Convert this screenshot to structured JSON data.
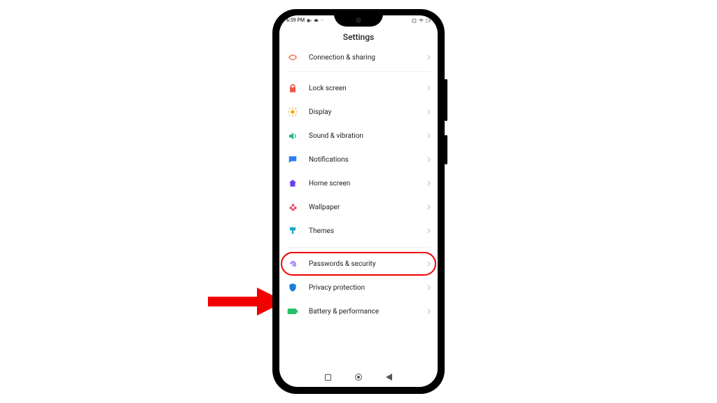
{
  "status": {
    "time": "6:59 PM",
    "icons_left": [
      "record-icon",
      "cloud-icon",
      "dots-icon"
    ],
    "icons_right": [
      "rotate-icon",
      "wifi-icon",
      "battery-icon"
    ]
  },
  "header": {
    "title": "Settings"
  },
  "groups": [
    {
      "rows": [
        {
          "id": "connection-sharing",
          "icon": "share-icon",
          "color": "#f26a3f",
          "label": "Connection & sharing"
        }
      ]
    },
    {
      "rows": [
        {
          "id": "lock-screen",
          "icon": "lock-icon",
          "color": "#f05a4a",
          "label": "Lock screen"
        },
        {
          "id": "display",
          "icon": "sun-icon",
          "color": "#f7a70b",
          "label": "Display"
        },
        {
          "id": "sound",
          "icon": "sound-icon",
          "color": "#1fbb7d",
          "label": "Sound & vibration"
        },
        {
          "id": "notifications",
          "icon": "msg-icon",
          "color": "#2e7bf6",
          "label": "Notifications"
        },
        {
          "id": "home-screen",
          "icon": "home-icon",
          "color": "#6a3df5",
          "label": "Home screen"
        },
        {
          "id": "wallpaper",
          "icon": "flower-icon",
          "color": "#e75470",
          "label": "Wallpaper"
        },
        {
          "id": "themes",
          "icon": "brush-icon",
          "color": "#1aa6c9",
          "label": "Themes"
        }
      ]
    },
    {
      "rows": [
        {
          "id": "passwords-security",
          "icon": "fingerprint-icon",
          "color": "#7a3df1",
          "label": "Passwords & security",
          "highlight": true
        },
        {
          "id": "privacy-protection",
          "icon": "shield-icon",
          "color": "#1a80d9",
          "label": "Privacy protection"
        },
        {
          "id": "battery-perf",
          "icon": "battery-big-icon",
          "color": "#27c06a",
          "label": "Battery & performance"
        }
      ]
    }
  ],
  "annotation": {
    "arrow_label": "arrow-to-passwords"
  }
}
